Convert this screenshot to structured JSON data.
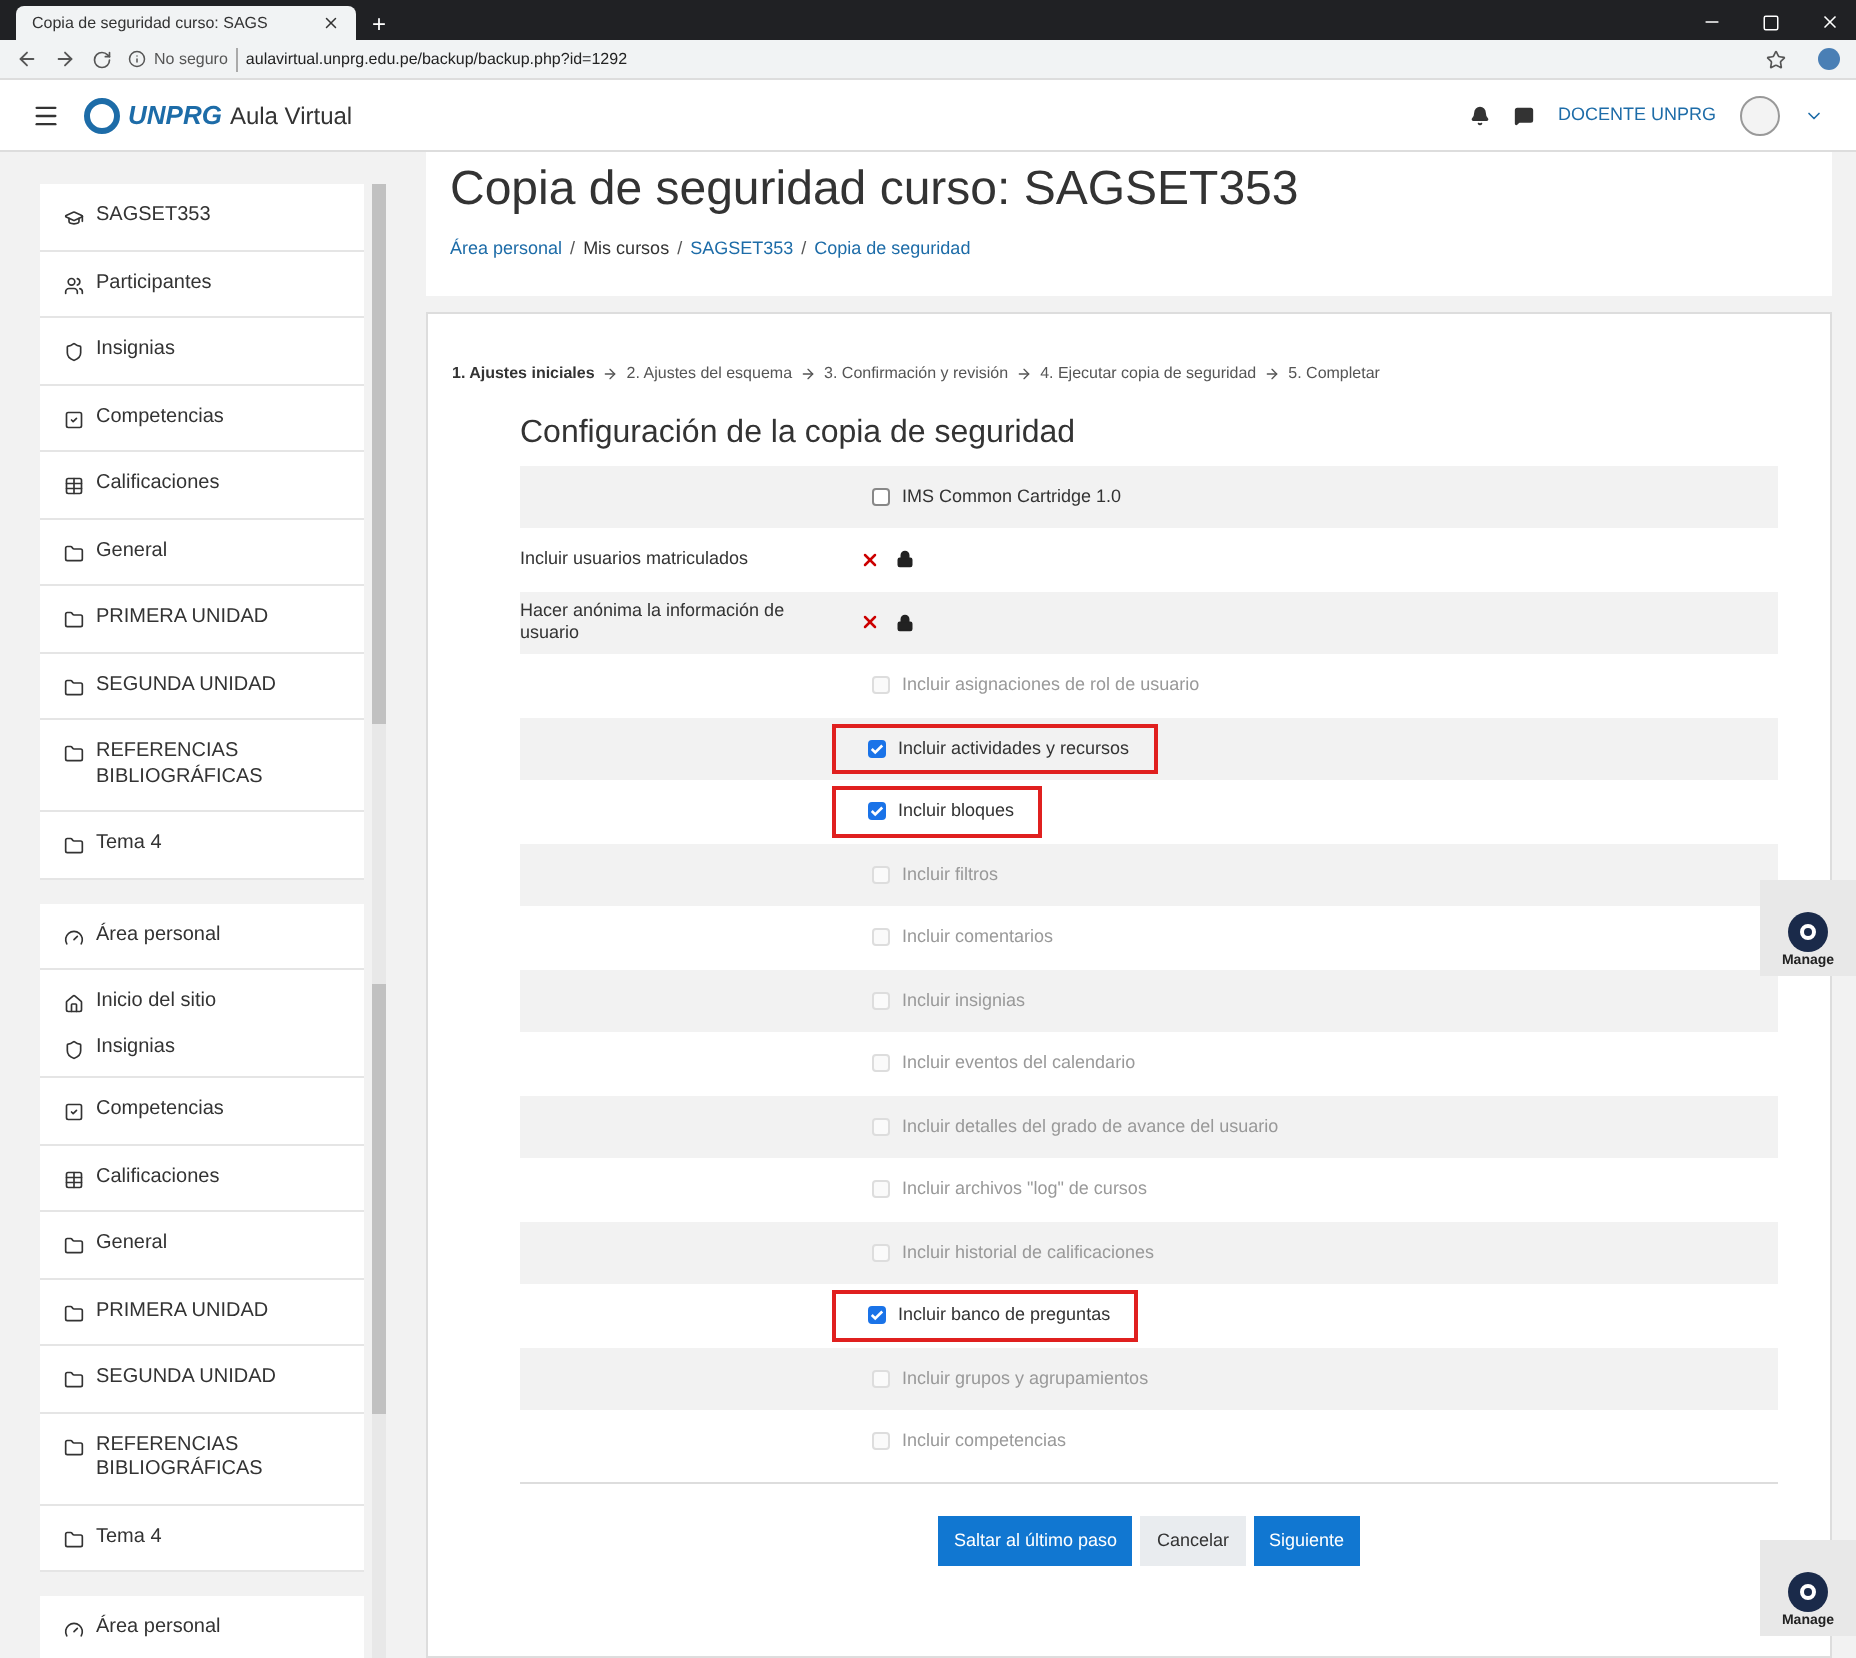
{
  "browser": {
    "tab_title": "Copia de seguridad curso: SAGS",
    "new_tab": "+",
    "security": "No seguro",
    "url": "aulavirtual.unprg.edu.pe/backup/backup.php?id=1292"
  },
  "navbar": {
    "logo": "UNPRG",
    "site": "Aula Virtual",
    "user": "DOCENTE UNPRG"
  },
  "sidebar": [
    {
      "items": [
        {
          "label": "SAGSET353"
        },
        {
          "label": "Participantes"
        },
        {
          "label": "Insignias"
        },
        {
          "label": "Competencias"
        },
        {
          "label": "Calificaciones"
        },
        {
          "label": "General"
        },
        {
          "label": "PRIMERA UNIDAD"
        },
        {
          "label": "SEGUNDA UNIDAD"
        },
        {
          "label": "REFERENCIAS BIBLIOGRÁFICAS"
        },
        {
          "label": "Tema 4"
        }
      ]
    },
    {
      "items": [
        {
          "label": "Área personal"
        },
        {
          "label": "Inicio del sitio",
          "children": [
            {
              "label": "Insignias"
            }
          ]
        },
        {
          "label": "Competencias"
        },
        {
          "label": "Calificaciones"
        },
        {
          "label": "General"
        },
        {
          "label": "PRIMERA UNIDAD"
        },
        {
          "label": "SEGUNDA UNIDAD"
        },
        {
          "label": "REFERENCIAS BIBLIOGRÁFICAS"
        },
        {
          "label": "Tema 4"
        }
      ]
    },
    {
      "items": [
        {
          "label": "Área personal"
        }
      ]
    }
  ],
  "page_title": "Copia de seguridad curso: SAGSET353",
  "breadcrumb": {
    "separator": "/",
    "items": [
      {
        "label": "Área personal",
        "link": true
      },
      {
        "label": "Mis cursos",
        "link": false
      },
      {
        "label": "SAGSET353",
        "link": true
      },
      {
        "label": "Copia de seguridad",
        "link": true
      }
    ]
  },
  "steps": [
    {
      "label": "1. Ajustes iniciales",
      "selected": true
    },
    {
      "label": "2. Ajustes del esquema",
      "selected": false
    },
    {
      "label": "3. Confirmación y revisión",
      "selected": false
    },
    {
      "label": "4. Ejecutar copia de seguridad",
      "selected": false
    },
    {
      "label": "5. Completar",
      "selected": false
    }
  ],
  "section_title": "Configuración de la copia de seguridad",
  "settings": [
    {
      "kind": "checkbox",
      "label": "IMS Common Cartridge 1.0",
      "checked": false,
      "disabled": false,
      "highlighted": false
    },
    {
      "kind": "locked",
      "label": "Incluir usuarios matriculados"
    },
    {
      "kind": "locked",
      "label": "Hacer anónima la información de usuario"
    },
    {
      "kind": "checkbox",
      "label": "Incluir asignaciones de rol de usuario",
      "checked": false,
      "disabled": true,
      "highlighted": false
    },
    {
      "kind": "checkbox",
      "label": "Incluir actividades y recursos",
      "checked": true,
      "disabled": false,
      "highlighted": true
    },
    {
      "kind": "checkbox",
      "label": "Incluir bloques",
      "checked": true,
      "disabled": false,
      "highlighted": true
    },
    {
      "kind": "checkbox",
      "label": "Incluir filtros",
      "checked": false,
      "disabled": true,
      "highlighted": false
    },
    {
      "kind": "checkbox",
      "label": "Incluir comentarios",
      "checked": false,
      "disabled": true,
      "highlighted": false
    },
    {
      "kind": "checkbox",
      "label": "Incluir insignias",
      "checked": false,
      "disabled": true,
      "highlighted": false
    },
    {
      "kind": "checkbox",
      "label": "Incluir eventos del calendario",
      "checked": false,
      "disabled": true,
      "highlighted": false
    },
    {
      "kind": "checkbox",
      "label": "Incluir detalles del grado de avance del usuario",
      "checked": false,
      "disabled": true,
      "highlighted": false
    },
    {
      "kind": "checkbox",
      "label": "Incluir archivos \"log\" de cursos",
      "checked": false,
      "disabled": true,
      "highlighted": false
    },
    {
      "kind": "checkbox",
      "label": "Incluir historial de calificaciones",
      "checked": false,
      "disabled": true,
      "highlighted": false
    },
    {
      "kind": "checkbox",
      "label": "Incluir banco de preguntas",
      "checked": true,
      "disabled": false,
      "highlighted": true
    },
    {
      "kind": "checkbox",
      "label": "Incluir grupos y agrupamientos",
      "checked": false,
      "disabled": true,
      "highlighted": false
    },
    {
      "kind": "checkbox",
      "label": "Incluir competencias",
      "checked": false,
      "disabled": true,
      "highlighted": false
    }
  ],
  "buttons": [
    {
      "label": "Saltar al último paso",
      "kind": "primary"
    },
    {
      "label": "Cancelar",
      "kind": "secondary"
    },
    {
      "label": "Siguiente",
      "kind": "primary"
    }
  ],
  "manage_badges": [
    {
      "label": "Manage"
    },
    {
      "label": "Manage"
    }
  ]
}
